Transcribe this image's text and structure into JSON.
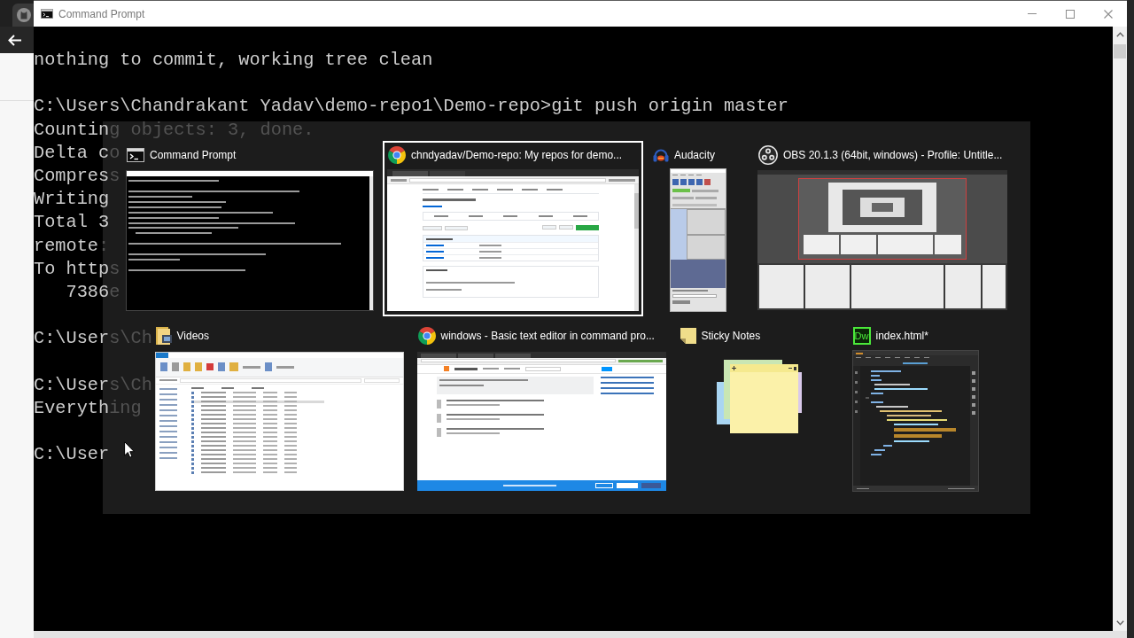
{
  "window": {
    "title": "Command Prompt"
  },
  "console": {
    "blocks": [
      [
        {
          "text": "nothing to commit, working tree clean"
        }
      ],
      [
        {
          "text": "C:\\Users\\Chandrakant Yadav\\demo-repo1\\Demo-repo>git push origin master"
        },
        {
          "text": "Countin",
          "faint": "g objects: 3, done."
        },
        {
          "text": "Delta c",
          "faint": "o"
        },
        {
          "text": "Compres",
          "faint": "s"
        },
        {
          "text": "Writing"
        },
        {
          "text": "Total 3"
        },
        {
          "text": "remote",
          "faint": ":"
        },
        {
          "text": "To http",
          "faint": "s"
        },
        {
          "text": "   7386",
          "faint": "e"
        }
      ],
      [
        {
          "text": "C:\\User",
          "faint": "s\\Ch"
        }
      ],
      [
        {
          "text": "C:\\User",
          "faint": "s\\Ch"
        },
        {
          "text": "Everyth",
          "faint": "ing"
        }
      ],
      [
        {
          "text": "C:\\User"
        }
      ]
    ]
  },
  "task_switcher": {
    "windows": [
      {
        "kind": "terminal",
        "title": "Command Prompt",
        "selected": false
      },
      {
        "kind": "repo",
        "title": "chndyadav/Demo-repo: My repos for demo...",
        "selected": true
      },
      {
        "kind": "audio",
        "title": "Audacity",
        "selected": false
      },
      {
        "kind": "recorder",
        "title": "OBS 20.1.3 (64bit, windows) - Profile: Untitle...",
        "selected": false
      },
      {
        "kind": "explorer",
        "title": "Videos",
        "selected": false
      },
      {
        "kind": "forum",
        "title": "windows - Basic text editor in command pro...",
        "selected": false
      },
      {
        "kind": "notes",
        "title": "Sticky Notes",
        "selected": false
      },
      {
        "kind": "editor",
        "title": "index.html*",
        "icon_text": "Dw",
        "selected": false
      }
    ]
  }
}
